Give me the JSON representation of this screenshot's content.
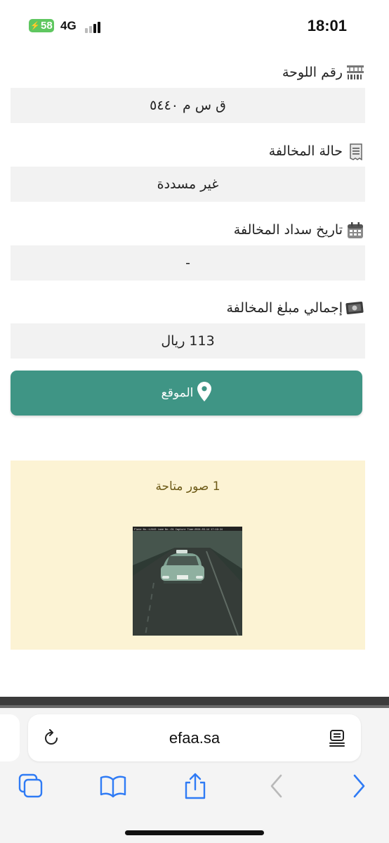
{
  "status_bar": {
    "battery": "58",
    "network": "4G",
    "time": "18:01"
  },
  "fields": [
    {
      "label": "رقم اللوحة",
      "icon": "barcode-icon",
      "value": "ق س م ٥٤٤٠"
    },
    {
      "label": "حالة المخالفة",
      "icon": "receipt-icon",
      "value": "غير مسددة"
    },
    {
      "label": "تاريخ سداد المخالفة",
      "icon": "calendar-icon",
      "value": "-"
    },
    {
      "label": "إجمالي مبلغ المخالفة",
      "icon": "banknote-icon",
      "value": "113 ريال"
    }
  ],
  "location_button": {
    "label": "الموقع",
    "icon": "map-pin-icon"
  },
  "images": {
    "title": "1 صور متاحة",
    "photo_caption": "Plate No.:L2443    Lane No.:01  Capture Time:2024-03-14  17:19:24"
  },
  "browser": {
    "url": "efaa.sa",
    "icons": [
      "reload-icon",
      "reader-icon",
      "tabs-icon",
      "bookmarks-icon",
      "share-icon",
      "back-icon",
      "forward-icon"
    ]
  },
  "colors": {
    "accent": "#3f9585",
    "panel": "#fcf3d4",
    "panel_text": "#6d5a17",
    "field_bg": "#f2f2f2",
    "ios_blue": "#2f7bf5",
    "battery": "#5fc760"
  }
}
